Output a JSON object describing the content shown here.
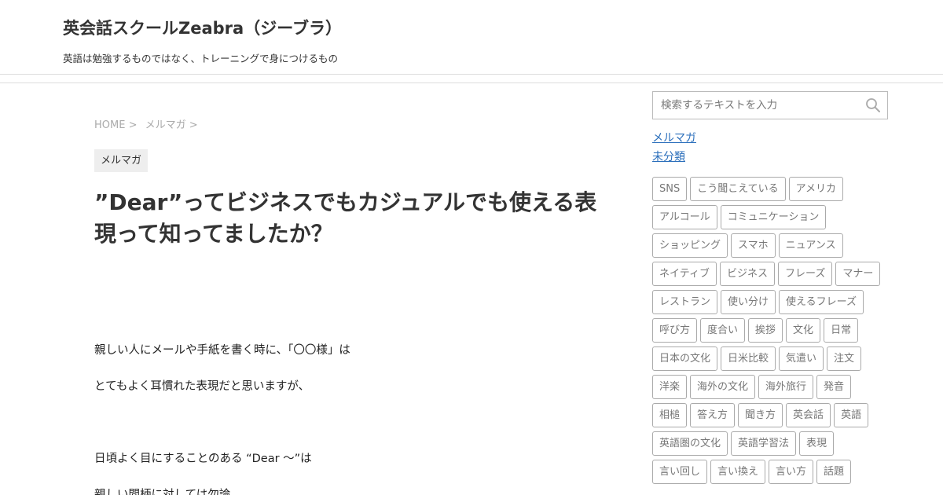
{
  "site": {
    "title": "英会話スクールZeabra（ジーブラ）",
    "description": "英語は勉強するものではなく、トレーニングで身につけるもの"
  },
  "breadcrumb": {
    "home": "HOME >",
    "category": "メルマガ >"
  },
  "post": {
    "category": "メルマガ",
    "title": "”Dear”ってビジネスでもカジュアルでも使える表現って知ってましたか？",
    "paragraphs": [
      "親しい人にメールや手紙を書く時に、「〇〇様」は",
      "とてもよく耳慣れた表現だと思いますが、",
      "日頃よく目にすることのある “Dear 〜”は",
      "親しい間柄に対しては勿論"
    ]
  },
  "sidebar": {
    "search_placeholder": "検索するテキストを入力",
    "search_icon": "search-icon",
    "categories": [
      "メルマガ",
      "未分類"
    ],
    "tag_rows": [
      [
        "SNS",
        "こう聞こえている",
        "アメリカ"
      ],
      [
        "アルコール",
        "コミュニケーション"
      ],
      [
        "ショッピング",
        "スマホ",
        "ニュアンス"
      ],
      [
        "ネイティブ",
        "ビジネス",
        "フレーズ",
        "マナー"
      ],
      [
        "レストラン",
        "使い分け",
        "使えるフレーズ"
      ],
      [
        "呼び方",
        "度合い",
        "挨拶",
        "文化",
        "日常"
      ],
      [
        "日本の文化",
        "日米比較",
        "気遣い",
        "注文"
      ],
      [
        "洋楽",
        "海外の文化",
        "海外旅行",
        "発音"
      ],
      [
        "相槌",
        "答え方",
        "聞き方",
        "英会話",
        "英語"
      ],
      [
        "英語圏の文化",
        "英語学習法",
        "表現"
      ],
      [
        "言い回し",
        "言い換え",
        "言い方",
        "話題"
      ]
    ]
  },
  "colors": {
    "link": "#2a6ebb",
    "tag_border": "#aaaaaa",
    "category_bg": "#eeeeee"
  }
}
